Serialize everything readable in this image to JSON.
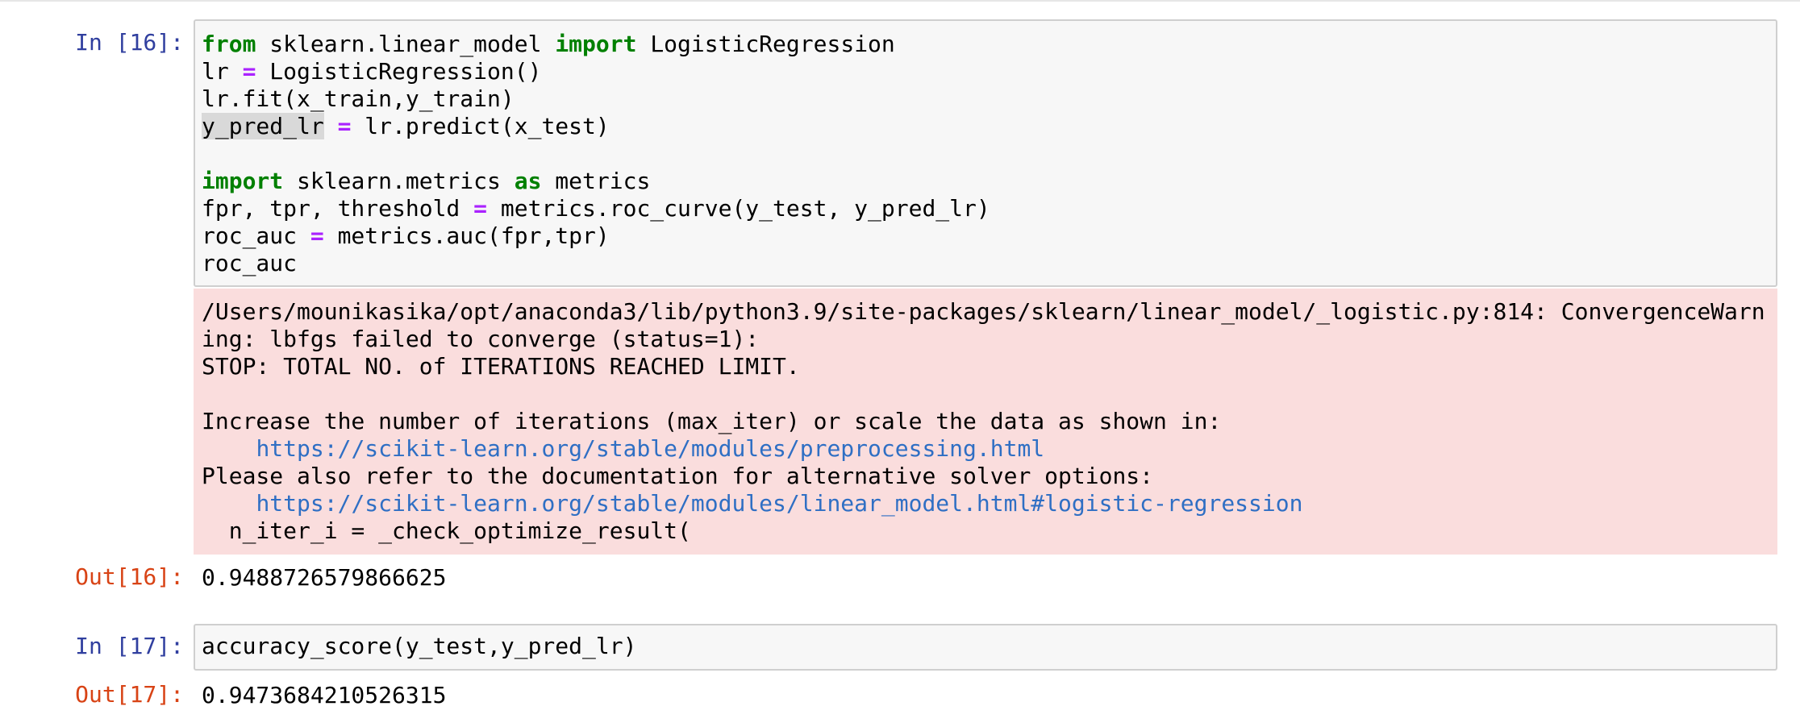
{
  "cell16": {
    "in_prompt": "In [16]:",
    "out_prompt": "Out[16]:",
    "lines": {
      "l1": {
        "a": "from",
        "b": " sklearn.linear_model ",
        "c": "import",
        "d": " LogisticRegression"
      },
      "l2": {
        "a": "lr ",
        "b": "=",
        "c": " LogisticRegression()"
      },
      "l3": {
        "a": "lr.fit(x_train,y_train)"
      },
      "l4": {
        "a": "y_pred_lr",
        "b": " ",
        "c": "=",
        "d": " lr.predict(x_test)"
      },
      "l5": {
        "a": ""
      },
      "l6": {
        "a": "import",
        "b": " sklearn.metrics ",
        "c": "as",
        "d": " metrics"
      },
      "l7": {
        "a": "fpr, tpr, threshold ",
        "b": "=",
        "c": " metrics.roc_curve(y_test, y_pred_lr)"
      },
      "l8": {
        "a": "roc_auc ",
        "b": "=",
        "c": " metrics.auc(fpr,tpr)"
      },
      "l9": {
        "a": "roc_auc"
      }
    },
    "stderr": {
      "s1": "/Users/mounikasika/opt/anaconda3/lib/python3.9/site-packages/sklearn/linear_model/_logistic.py:814: ConvergenceWarn",
      "s2": "ing: lbfgs failed to converge (status=1):",
      "s3": "STOP: TOTAL NO. of ITERATIONS REACHED LIMIT.",
      "s4": "",
      "s5": "Increase the number of iterations (max_iter) or scale the data as shown in:",
      "s6_indent": "    ",
      "s6_link": "https://scikit-learn.org/stable/modules/preprocessing.html",
      "s7": "Please also refer to the documentation for alternative solver options:",
      "s8_indent": "    ",
      "s8_link": "https://scikit-learn.org/stable/modules/linear_model.html#logistic-regression",
      "s9": "  n_iter_i = _check_optimize_result("
    },
    "output": "0.9488726579866625"
  },
  "cell17": {
    "in_prompt": "In [17]:",
    "out_prompt": "Out[17]:",
    "code": "accuracy_score(y_test,y_pred_lr)",
    "output": "0.9473684210526315"
  },
  "colors": {
    "keyword": "#008000",
    "operator": "#aa22ff",
    "in_prompt": "#303f9f",
    "out_prompt": "#d84315",
    "stderr_bg": "#fadddd",
    "link": "#2f6fc4"
  }
}
